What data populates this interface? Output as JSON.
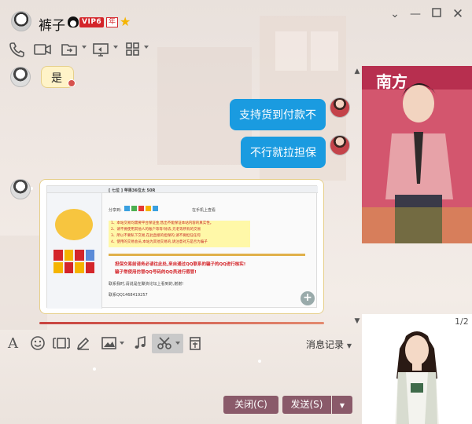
{
  "window": {
    "contact_name": "裤子",
    "vip_label": "VIP6",
    "year_label": "年"
  },
  "toolbar": {
    "items": [
      "phone-icon",
      "video-icon",
      "folder-transfer-icon",
      "screen-share-icon",
      "apps-icon"
    ]
  },
  "chat": {
    "messages": [
      {
        "side": "left",
        "text": "是"
      },
      {
        "side": "right",
        "text": "支持货到付款不"
      },
      {
        "side": "right",
        "text": "不行就拉担保"
      },
      {
        "side": "left",
        "type": "image"
      }
    ]
  },
  "screenshot_content": {
    "thread_title": "[ 七位 ] 苹果36位太 50R",
    "lines": [
      "1、本站交易均需要平台保证金,售出不能保证本站内容的真实性。",
      "2、请不要使用其他人的账户等等!除去,元老等所有的交易",
      "3、所以不要私下交易,在此直接的担保的,请不要担任任何",
      "4、使用的交易会员,本站为其他交易的,请注意对方是否为骗子"
    ],
    "red_lines": [
      "担保交易前请务必请往此处,来自通过QQ联系的骗子的QQ进行核实!",
      "骗子常使用仿冒QQ号码的QQ员进行假冒!"
    ],
    "contact_note": "联系我时,请说是在聚资论坛上看到的,谢谢!",
    "contact_qq": "联系QQ1468419257",
    "share_label": "分享到:",
    "mobile_label": "在手机上查看"
  },
  "input_toolbar": {
    "history_label": "消息记录"
  },
  "buttons": {
    "close_label": "关闭(C)",
    "send_label": "发送(S)"
  },
  "ad": {
    "top_text": "南方",
    "page_indicator": "1/2"
  },
  "colors": {
    "bubble_right": "#1a9be0",
    "bubble_left": "#fff3c8",
    "button": "#8a5a6a",
    "vip_red": "#d4252a"
  }
}
